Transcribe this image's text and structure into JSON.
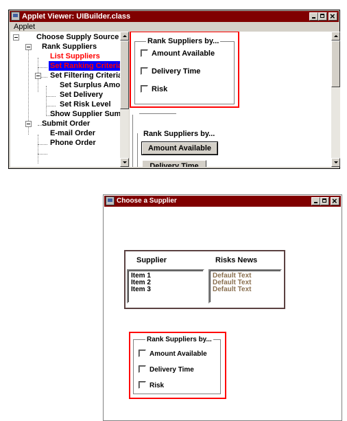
{
  "window1": {
    "title": "Applet Viewer: UIBuilder.class",
    "menu": "Applet",
    "tree": {
      "root": "Choose Supply Source",
      "rank": "Rank Suppliers",
      "list_suppliers": "List Suppliers",
      "set_ranking": "Set Ranking Criteria",
      "set_filtering": "Set Filtering Criteria",
      "set_surplus": "Set Surplus Amount",
      "set_delivery": "Set Delivery",
      "set_risk": "Set Risk Level",
      "show_supplier": "Show Supplier Summary",
      "submit_order": "Submit Order",
      "email_order": "E-mail Order",
      "phone_order": "Phone Order"
    },
    "rank_group": {
      "label": "Rank Suppliers by...",
      "options": [
        "Amount Available",
        "Delivery Time",
        "Risk"
      ]
    },
    "rank_buttons": {
      "label": "Rank Suppliers by...",
      "buttons": [
        "Amount Available",
        "Delivery Time"
      ]
    }
  },
  "window2": {
    "title": "Choose a Supplier",
    "supplier_header": "Supplier",
    "risks_header": "Risks News",
    "suppliers": [
      "Item 1",
      "Item 2",
      "Item 3"
    ],
    "risks": [
      "Default Text",
      "Default Text",
      "Default Text"
    ],
    "rank_group": {
      "label": "Rank Suppliers by...",
      "options": [
        "Amount Available",
        "Delivery Time",
        "Risk"
      ]
    }
  },
  "colors": {
    "titlebar": "#800000",
    "highlight": "#ff0000",
    "selection": "#0000ff"
  }
}
